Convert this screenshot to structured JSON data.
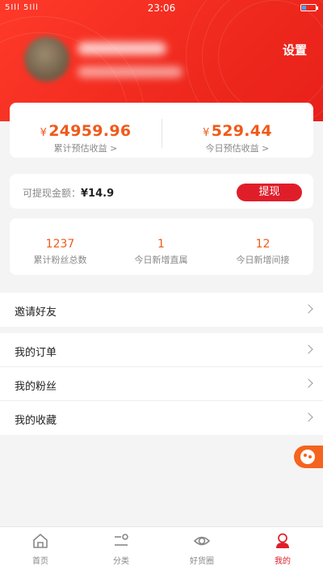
{
  "status_bar": {
    "signal": "5Ill 5Ill",
    "time": "23:06"
  },
  "profile": {
    "settings_label": "设置"
  },
  "earnings": {
    "currency": "¥",
    "total_amount": "24959.96",
    "total_label": "累计预估收益 >",
    "today_amount": "529.44",
    "today_label": "今日预估收益 >"
  },
  "withdraw": {
    "label": "可提现金额：",
    "value": "¥14.9",
    "button_label": "提现"
  },
  "fans_stats": [
    {
      "value": "1237",
      "label": "累计粉丝总数"
    },
    {
      "value": "1",
      "label": "今日新增直属"
    },
    {
      "value": "12",
      "label": "今日新增间接"
    }
  ],
  "menu": [
    {
      "label": "邀请好友"
    },
    {
      "label": "我的订单"
    },
    {
      "label": "我的粉丝"
    },
    {
      "label": "我的收藏"
    }
  ],
  "tabs": [
    {
      "label": "首页",
      "icon": "home-icon"
    },
    {
      "label": "分类",
      "icon": "category-icon"
    },
    {
      "label": "好货圈",
      "icon": "eye-icon"
    },
    {
      "label": "我的",
      "icon": "user-icon"
    }
  ],
  "colors": {
    "brand_red": "#e01e2a",
    "amount_orange": "#f05a1a",
    "float_orange": "#f4641e"
  }
}
